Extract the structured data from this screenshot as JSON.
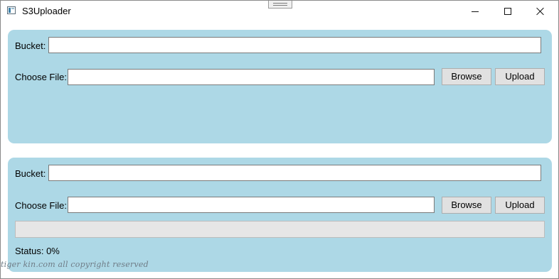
{
  "window": {
    "title": "S3Uploader",
    "icon": "app-window-icon",
    "controls": {
      "minimize_icon": "minimize-icon",
      "maximize_icon": "maximize-icon",
      "close_icon": "close-icon"
    }
  },
  "colors": {
    "panel_background": "#add8e6",
    "button_background": "#e1e1e1",
    "progress_track": "#e6e6e6",
    "progress_fill": "#06b025"
  },
  "panels": [
    {
      "bucket_label": "Bucket:",
      "bucket_value": "",
      "file_label": "Choose File:",
      "file_value": "",
      "browse_label": "Browse",
      "upload_label": "Upload"
    },
    {
      "bucket_label": "Bucket:",
      "bucket_value": "",
      "file_label": "Choose File:",
      "file_value": "",
      "browse_label": "Browse",
      "upload_label": "Upload",
      "progress": 0,
      "status_text": "Status: 0%"
    }
  ],
  "watermark": "tiger kin.com all copyright reserved"
}
